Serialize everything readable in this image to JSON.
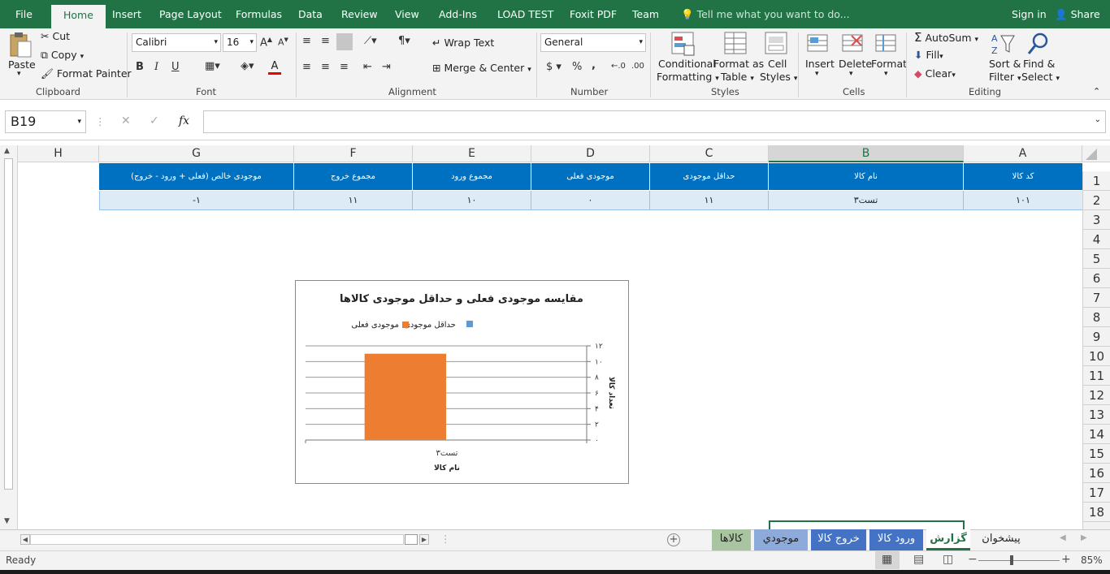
{
  "ribbon_tabs": [
    "File",
    "Home",
    "Insert",
    "Page Layout",
    "Formulas",
    "Data",
    "Review",
    "View",
    "Add-Ins",
    "LOAD TEST",
    "Foxit PDF",
    "Team"
  ],
  "tell_me": "Tell me what you want to do...",
  "sign_in": "Sign in",
  "share": "Share",
  "clipboard": {
    "paste": "Paste",
    "cut": "Cut",
    "copy": "Copy",
    "format_painter": "Format Painter",
    "label": "Clipboard"
  },
  "font": {
    "name": "Calibri",
    "size": "16",
    "label": "Font",
    "bold": "B",
    "italic": "I",
    "underline": "U"
  },
  "alignment": {
    "wrap": "Wrap Text",
    "merge": "Merge & Center",
    "label": "Alignment"
  },
  "number": {
    "format": "General",
    "currency": "$",
    "percent": "%",
    "comma": ",",
    "label": "Number"
  },
  "styles": {
    "cond_1": "Conditional",
    "cond_2": "Formatting",
    "fat_1": "Format as",
    "fat_2": "Table",
    "cell_1": "Cell",
    "cell_2": "Styles",
    "label": "Styles"
  },
  "cells": {
    "insert": "Insert",
    "delete": "Delete",
    "format": "Format",
    "label": "Cells"
  },
  "editing": {
    "autosum": "AutoSum",
    "fill": "Fill",
    "clear": "Clear",
    "sort_1": "Sort &",
    "sort_2": "Filter",
    "find_1": "Find &",
    "find_2": "Select",
    "label": "Editing"
  },
  "name_box": "B19",
  "formula": "",
  "columns": [
    "H",
    "G",
    "F",
    "E",
    "D",
    "C",
    "B",
    "A"
  ],
  "rows": [
    "1",
    "2",
    "3",
    "4",
    "5",
    "6",
    "7",
    "8",
    "9",
    "10",
    "11",
    "12",
    "13",
    "14",
    "15",
    "16",
    "17",
    "18"
  ],
  "table": {
    "headers": {
      "G": "موجودی خالص (فعلی + ورود - خروج)",
      "F": "مجموع خروج",
      "E": "مجموع ورود",
      "D": "موجودی فعلی",
      "C": "حداقل موجودی",
      "B": "نام کالا",
      "A": "کد کالا"
    },
    "row": {
      "G": "-۱",
      "F": "۱۱",
      "E": "۱۰",
      "D": "۰",
      "C": "۱۱",
      "B": "تست۳",
      "A": "۱۰۱"
    }
  },
  "chart_data": {
    "type": "bar",
    "title": "مقایسه موجودی فعلی و حداقل موجودی کالاها",
    "categories": [
      "تست۳"
    ],
    "series": [
      {
        "name": "موجودی فعلی",
        "values": [
          0
        ],
        "color": "#5b9bd5"
      },
      {
        "name": "حداقل موجودی",
        "values": [
          11
        ],
        "color": "#ed7d31"
      }
    ],
    "xlabel": "نام کالا",
    "ylabel": "تعداد کالا",
    "ylim": [
      0,
      12
    ],
    "yticks": [
      "۰",
      "۲",
      "۴",
      "۶",
      "۸",
      "۱۰",
      "۱۲"
    ],
    "legend": "top",
    "grid": true
  },
  "sheets": [
    "کالاها",
    "موجودي",
    "خروج کالا",
    "ورود کالا",
    "گزارش",
    "پیشخوان"
  ],
  "status": {
    "ready": "Ready",
    "zoom": "85%"
  }
}
